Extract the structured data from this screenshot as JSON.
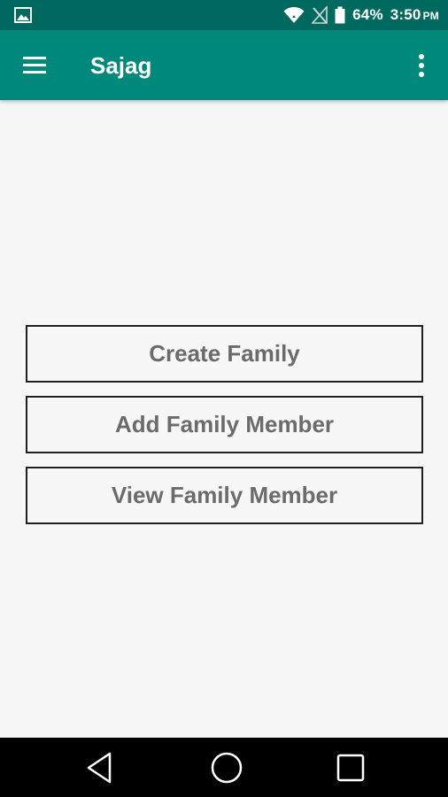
{
  "status_bar": {
    "notification_icon": "image-icon",
    "wifi_icon": "wifi-icon",
    "signal_icon": "no-signal-icon",
    "battery_icon": "battery-icon",
    "battery_percent": "64%",
    "time": "3:50",
    "ampm": "PM"
  },
  "app_bar": {
    "title": "Sajag",
    "menu_icon": "hamburger-menu-icon",
    "overflow_icon": "more-vert-icon",
    "color": "#00897b",
    "status_color": "#00695f"
  },
  "actions": {
    "create_family": "Create Family",
    "add_family_member": "Add Family Member",
    "view_family_member": "View Family Member"
  },
  "nav_bar": {
    "back_icon": "back-triangle-icon",
    "home_icon": "home-circle-icon",
    "recents_icon": "recents-square-icon"
  }
}
